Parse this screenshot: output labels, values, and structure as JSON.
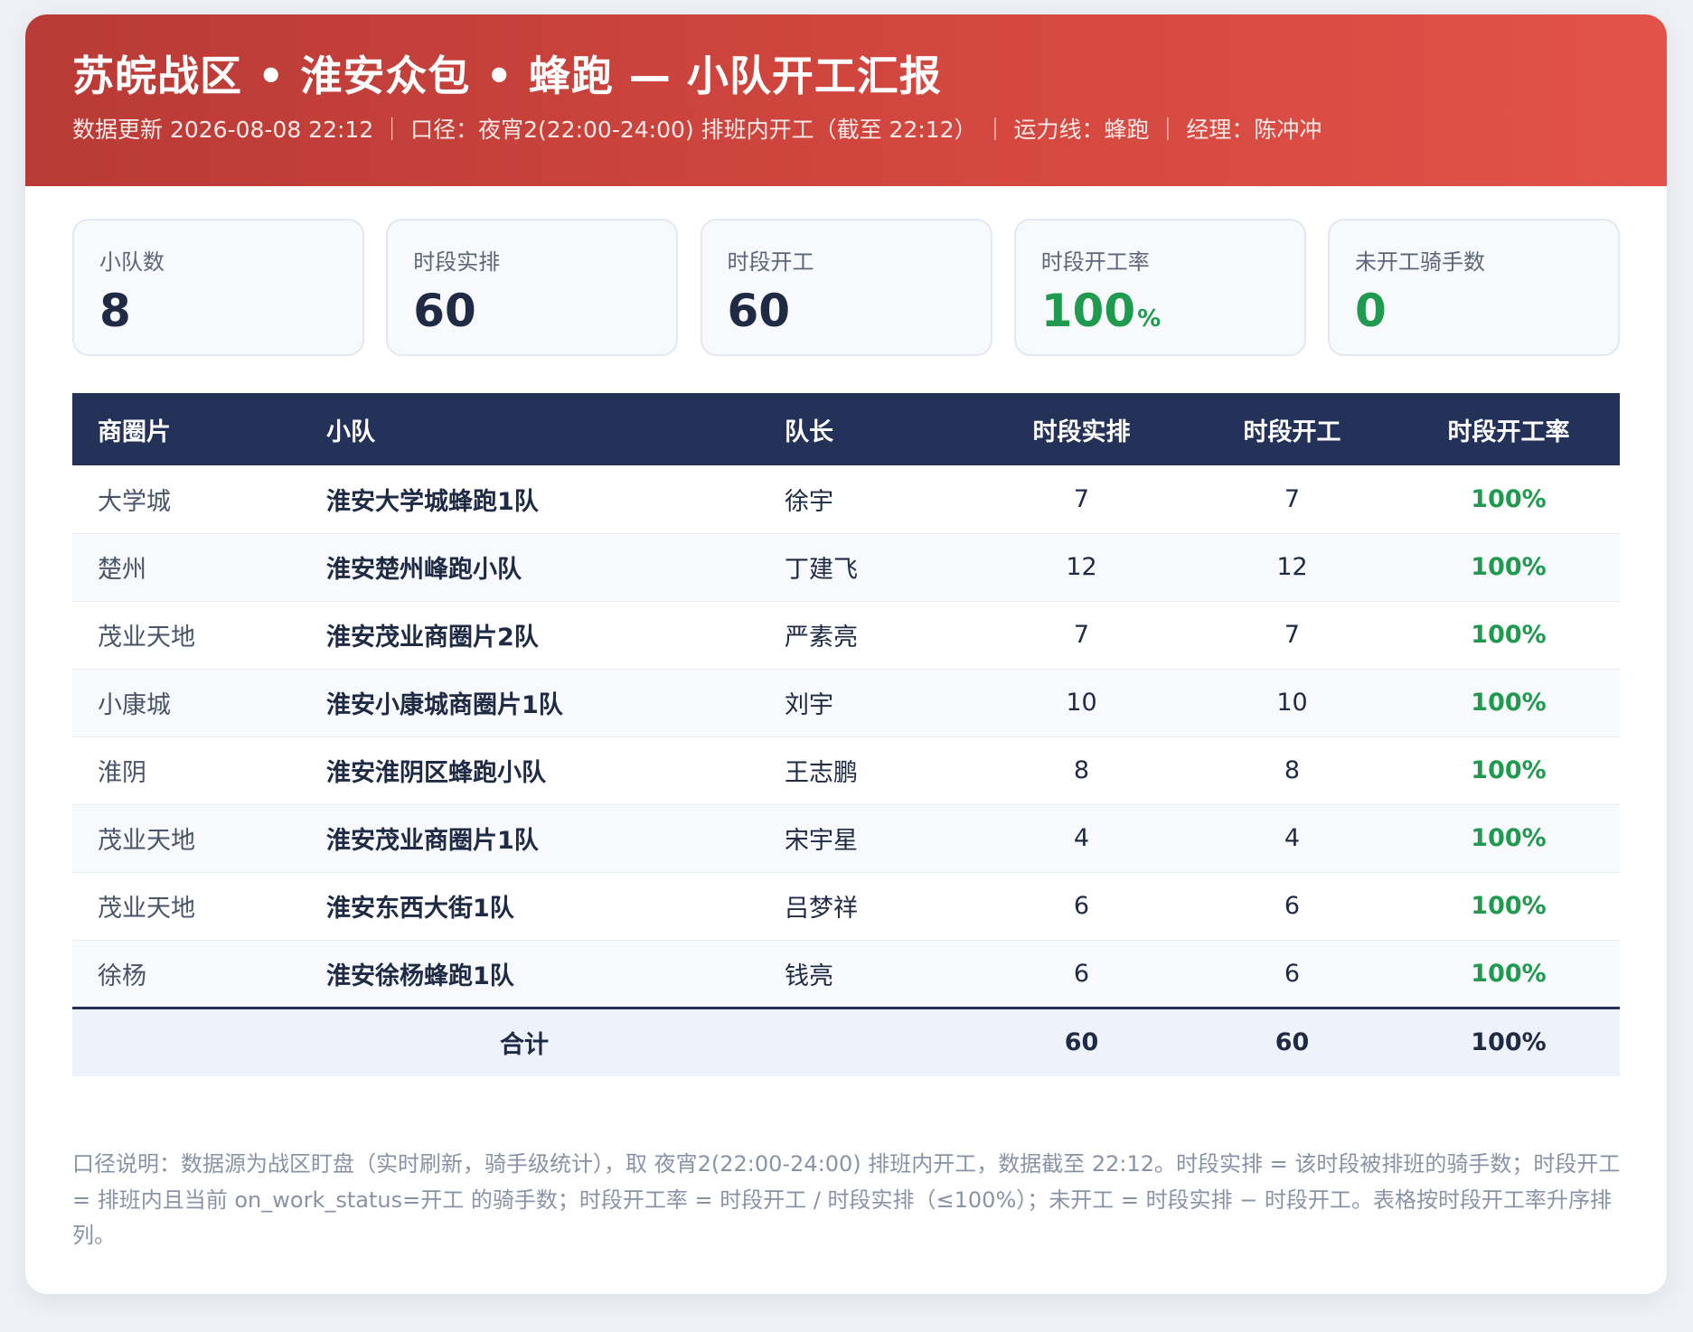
{
  "header": {
    "title": "苏皖战区 • 淮安众包 • 蜂跑 — 小队开工汇报",
    "subtitle": "数据更新 2026-08-08 22:12 ｜ 口径：夜宵2(22:00-24:00) 排班内开工（截至 22:12） ｜ 运力线：蜂跑 ｜ 经理：陈冲冲"
  },
  "stats": [
    {
      "label": "小队数",
      "value": "8",
      "unit": ""
    },
    {
      "label": "时段实排",
      "value": "60",
      "unit": ""
    },
    {
      "label": "时段开工",
      "value": "60",
      "unit": ""
    },
    {
      "label": "时段开工率",
      "value": "100",
      "unit": "%"
    },
    {
      "label": "未开工骑手数",
      "value": "0",
      "unit": ""
    }
  ],
  "table": {
    "headers": [
      "商圈片",
      "小队",
      "队长",
      "时段实排",
      "时段开工",
      "时段开工率"
    ],
    "rows": [
      {
        "area": "大学城",
        "team": "淮安大学城蜂跑1队",
        "leader": "徐宇",
        "planned": "7",
        "working": "7",
        "rate": "100%"
      },
      {
        "area": "楚州",
        "team": "淮安楚州峰跑小队",
        "leader": "丁建飞",
        "planned": "12",
        "working": "12",
        "rate": "100%"
      },
      {
        "area": "茂业天地",
        "team": "淮安茂业商圈片2队",
        "leader": "严素亮",
        "planned": "7",
        "working": "7",
        "rate": "100%"
      },
      {
        "area": "小康城",
        "team": "淮安小康城商圈片1队",
        "leader": "刘宇",
        "planned": "10",
        "working": "10",
        "rate": "100%"
      },
      {
        "area": "淮阴",
        "team": "淮安淮阴区蜂跑小队",
        "leader": "王志鹏",
        "planned": "8",
        "working": "8",
        "rate": "100%"
      },
      {
        "area": "茂业天地",
        "team": "淮安茂业商圈片1队",
        "leader": "宋宇星",
        "planned": "4",
        "working": "4",
        "rate": "100%"
      },
      {
        "area": "茂业天地",
        "team": "淮安东西大街1队",
        "leader": "吕梦祥",
        "planned": "6",
        "working": "6",
        "rate": "100%"
      },
      {
        "area": "徐杨",
        "team": "淮安徐杨蜂跑1队",
        "leader": "钱亮",
        "planned": "6",
        "working": "6",
        "rate": "100%"
      }
    ],
    "total": {
      "label": "合计",
      "planned": "60",
      "working": "60",
      "rate": "100%"
    }
  },
  "note": "口径说明：数据源为战区盯盘（实时刷新，骑手级统计），取 夜宵2(22:00-24:00) 排班内开工，数据截至 22:12。时段实排 = 该时段被排班的骑手数；时段开工 = 排班内且当前 on_work_status=开工 的骑手数；时段开工率 = 时段开工 / 时段实排（≤100%）；未开工 = 时段实排 − 时段开工。表格按时段开工率升序排列。",
  "colors": {
    "header_red": "#d2473f",
    "navy": "#24325a",
    "green": "#1f9a4e"
  }
}
